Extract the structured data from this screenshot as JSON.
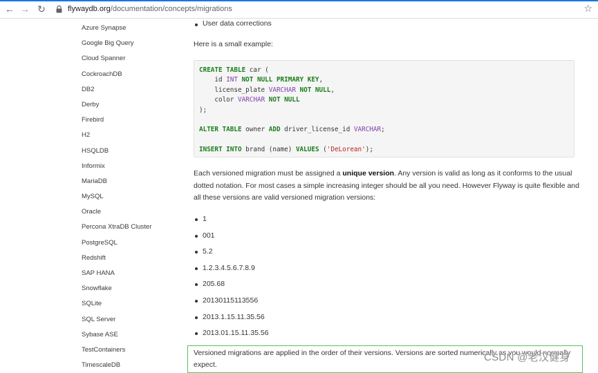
{
  "browser": {
    "url_host": "flywaydb.org",
    "url_path": "/documentation/concepts/migrations",
    "back_icon": "←",
    "forward_icon": "→",
    "reload_icon": "↻",
    "star_icon": "☆"
  },
  "sidebar": {
    "items": [
      "Azure Synapse",
      "Google Big Query",
      "Cloud Spanner",
      "CockroachDB",
      "DB2",
      "Derby",
      "Firebird",
      "H2",
      "HSQLDB",
      "Informix",
      "MariaDB",
      "MySQL",
      "Oracle",
      "Percona XtraDB Cluster",
      "PostgreSQL",
      "Redshift",
      "SAP HANA",
      "Snowflake",
      "SQLite",
      "SQL Server",
      "Sybase ASE",
      "TestContainers",
      "TimescaleDB"
    ]
  },
  "main": {
    "top_bullet": "User data corrections",
    "intro": "Here is a small example:",
    "code": {
      "l1_kw": "CREATE TABLE",
      "l1_rest": " car (",
      "l2_pre": "    id ",
      "l2_ty": "INT",
      "l2_kw": " NOT NULL PRIMARY KEY",
      "l2_post": ",",
      "l3_pre": "    license_plate ",
      "l3_ty": "VARCHAR",
      "l3_kw": " NOT NULL",
      "l3_post": ",",
      "l4_pre": "    color ",
      "l4_ty": "VARCHAR",
      "l4_kw": " NOT NULL",
      "l5": ");",
      "l6_kw": "ALTER TABLE",
      "l6_mid": " owner ",
      "l6_kw2": "ADD",
      "l6_mid2": " driver_license_id ",
      "l6_ty": "VARCHAR",
      "l6_post": ";",
      "l7_kw": "INSERT INTO",
      "l7_mid": " brand (name) ",
      "l7_kw2": "VALUES",
      "l7_pre_str": " (",
      "l7_str": "'DeLorean'",
      "l7_post": ");"
    },
    "para_pre": "Each versioned migration must be assigned a ",
    "para_bold": "unique version",
    "para_post": ". Any version is valid as long as it conforms to the usual dotted notation. For most cases a simple increasing integer should be all you need. However Flyway is quite flexible and all these versions are valid versioned migration versions:",
    "versions": [
      "1",
      "001",
      "5.2",
      "1.2.3.4.5.6.7.8.9",
      "205.68",
      "20130115113556",
      "2013.1.15.11.35.56",
      "2013.01.15.11.35.56"
    ],
    "callout": "Versioned migrations are applied in the order of their versions. Versions are sorted numerically as you would normally expect."
  },
  "watermark": "CSDN @老汉健身",
  "colors": {
    "keyword": "#1c7d1c",
    "type": "#7c3fa8",
    "string": "#ba2121",
    "callout_border": "#56c25a",
    "accent": "#1a73e8"
  }
}
